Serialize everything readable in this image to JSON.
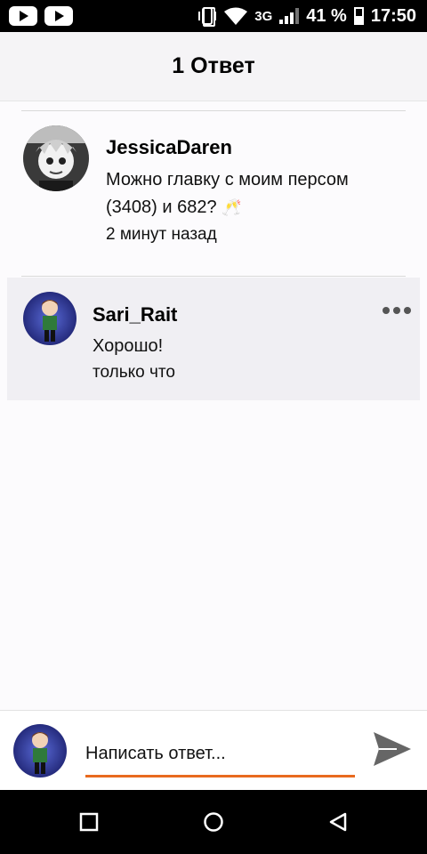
{
  "status_bar": {
    "network": "3G",
    "battery": "41 %",
    "time": "17:50",
    "icons": [
      "youtube-icon",
      "youtube-icon",
      "vibrate-icon",
      "wifi-icon",
      "signal-icon",
      "battery-icon"
    ]
  },
  "header": {
    "title": "1 Ответ"
  },
  "comments": [
    {
      "author": "JessicaDaren",
      "text_line1": "Можно главку с моим персом",
      "text_line2": "(3408) и 682?",
      "emoji": "🥂",
      "time": "2 минут назад"
    },
    {
      "author": "Sari_Rait",
      "text": "Хорошо!",
      "time": "только что"
    }
  ],
  "reply": {
    "placeholder": "Написать ответ...",
    "accent_color": "#e86a1e"
  },
  "nav": {
    "icons": [
      "square-icon",
      "circle-icon",
      "back-triangle-icon"
    ]
  }
}
